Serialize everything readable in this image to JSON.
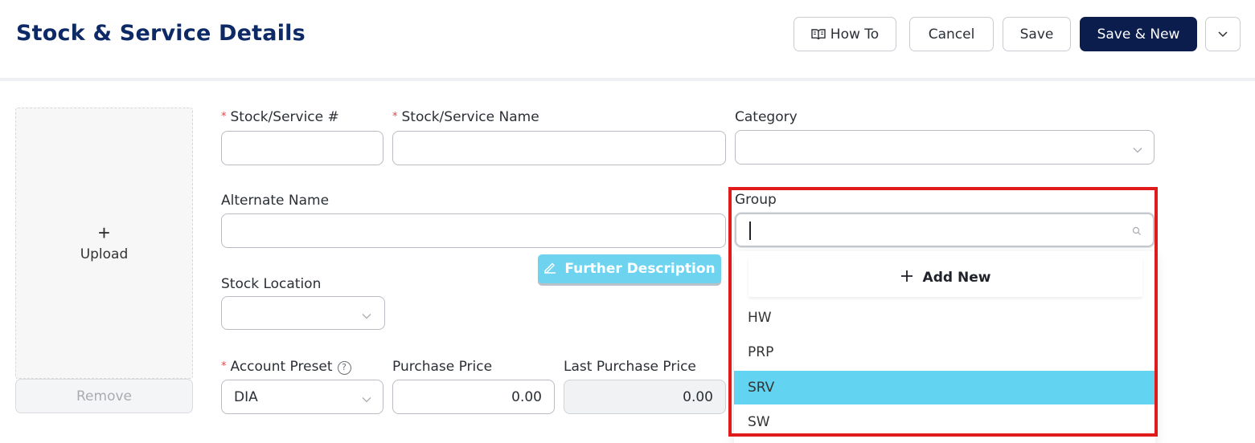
{
  "header": {
    "title": "Stock & Service Details",
    "buttons": {
      "how_to": "How To",
      "cancel": "Cancel",
      "save": "Save",
      "save_new": "Save & New"
    }
  },
  "upload": {
    "label": "Upload",
    "plus": "+",
    "remove": "Remove"
  },
  "form": {
    "required_marker": "*",
    "stock_no": {
      "label": "Stock/Service #",
      "value": ""
    },
    "stock_name": {
      "label": "Stock/Service Name",
      "value": ""
    },
    "category": {
      "label": "Category",
      "value": ""
    },
    "alternate_name": {
      "label": "Alternate Name",
      "value": ""
    },
    "group": {
      "label": "Group",
      "value": ""
    },
    "further_description": "Further Description",
    "stock_location": {
      "label": "Stock Location",
      "value": ""
    },
    "account_preset": {
      "label": "Account Preset",
      "value": "DIA",
      "help": "?"
    },
    "purchase_price": {
      "label": "Purchase Price",
      "value": "0.00"
    },
    "last_purchase_price": {
      "label": "Last Purchase Price",
      "value": "0.00"
    }
  },
  "group_dropdown": {
    "add_new": "Add New",
    "options": [
      {
        "label": "HW",
        "selected": false
      },
      {
        "label": "PRP",
        "selected": false
      },
      {
        "label": "SRV",
        "selected": true
      },
      {
        "label": "SW",
        "selected": false
      }
    ]
  },
  "colors": {
    "title": "#0d2a66",
    "primary_button": "#0b1d4d",
    "accent": "#6dd3ef",
    "selected_option": "#62d3f1",
    "required": "#e04848",
    "highlight_border": "#e01b1b"
  },
  "icons": [
    "book-icon",
    "chevron-down-icon",
    "plus-icon",
    "pencil-icon",
    "search-icon",
    "help-icon"
  ]
}
